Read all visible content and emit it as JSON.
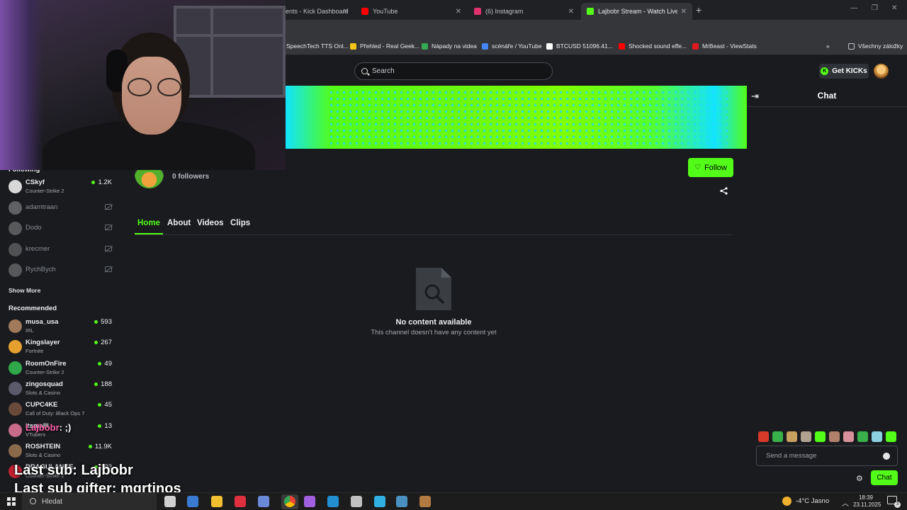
{
  "browser": {
    "tabs": [
      {
        "title": "ents - Kick Dashboard",
        "color": "#53fc18"
      },
      {
        "title": "YouTube",
        "color": "#ff0000"
      },
      {
        "title": "(6) Instagram",
        "color": "#e1306c"
      },
      {
        "title": "Lajbobr Stream - Watch Live on",
        "color": "#53fc18"
      }
    ],
    "bookmarks": [
      {
        "label": "SpeechTech TTS Onl...",
        "color": "#4aa3ff"
      },
      {
        "label": "Přehled - Real Geek...",
        "color": "#f5c518"
      },
      {
        "label": "Nápady na videa",
        "color": "#34a853"
      },
      {
        "label": "scénáře / YouTube",
        "color": "#4285f4"
      },
      {
        "label": "BTCUSD 51096.41...",
        "color": "#ffffff"
      },
      {
        "label": "Shocked sound effe...",
        "color": "#ff0000"
      },
      {
        "label": "MrBeast - ViewStats",
        "color": "#e0191f"
      },
      {
        "label": "Všechny záložky",
        "color": "#bdc1c6"
      }
    ]
  },
  "header": {
    "search_placeholder": "Search",
    "get_kicks_label": "Get KICKs"
  },
  "sidebar": {
    "following_title": "Following",
    "following": [
      {
        "name": "CSkyf",
        "category": "Counter-Strike 2",
        "viewers": "1.2K",
        "live": true,
        "color": "#d8d8d8"
      },
      {
        "name": "adamtraan",
        "live": false,
        "color": "#9a9a9a"
      },
      {
        "name": "Dodo",
        "live": false,
        "color": "#8c8c8c"
      },
      {
        "name": "krecmer",
        "live": false,
        "color": "#7d7d7d"
      },
      {
        "name": "RychBych",
        "live": false,
        "color": "#8a8a8a"
      }
    ],
    "show_more_label": "Show More",
    "recommended_title": "Recommended",
    "recommended": [
      {
        "name": "musa_usa",
        "category": "IRL",
        "viewers": "593",
        "color": "#a07a5a"
      },
      {
        "name": "Kingslayer",
        "category": "Fortnite",
        "viewers": "267",
        "color": "#e6a030"
      },
      {
        "name": "RoomOnFire",
        "category": "Counter-Strike 2",
        "viewers": "49",
        "color": "#2fa84a"
      },
      {
        "name": "zingosquad",
        "category": "Slots & Casino",
        "viewers": "188",
        "color": "#5a5a6a"
      },
      {
        "name": "CUPC4KE",
        "category": "Call of Duty: Black Ops 7",
        "viewers": "45",
        "color": "#6a4a3a"
      },
      {
        "name": "itsmalli",
        "category": "VTubers",
        "viewers": "13",
        "color": "#c86a8a"
      },
      {
        "name": "ROSHTEIN",
        "category": "Slots & Casino",
        "viewers": "11.9K",
        "color": "#8a6a4a"
      },
      {
        "name": "DRAGULANCE",
        "category": "Counter-Strike 2",
        "viewers": "383",
        "color": "#c02030"
      }
    ]
  },
  "channel": {
    "followers_text": "0 followers",
    "follow_label": "Follow",
    "tabs": [
      "Home",
      "About",
      "Videos",
      "Clips"
    ],
    "empty_title": "No content available",
    "empty_subtitle": "This channel doesn't have any content yet"
  },
  "chat": {
    "title": "Chat",
    "input_placeholder": "Send a message",
    "send_label": "Chat",
    "emote_colors": [
      "#d83a2a",
      "#3ab04a",
      "#c8a060",
      "#b0a090",
      "#53fc18",
      "#b0806a",
      "#d8909a",
      "#3ab04a",
      "#8ad0e0",
      "#53fc18"
    ]
  },
  "overlay": {
    "chat_user": "Lajbobr",
    "chat_message": ": ;)",
    "last_sub": "Last sub: Lajbobr",
    "last_gifter": "Last sub gifter: mqrtinos"
  },
  "taskbar": {
    "search_label": "Hledat",
    "apps": [
      {
        "icon": "task-view-icon",
        "color": "#d0d0d0"
      },
      {
        "icon": "calculator-app-icon",
        "color": "#3a7ad0"
      },
      {
        "icon": "file-explorer-icon",
        "color": "#f0c030"
      },
      {
        "icon": "app-red-icon",
        "color": "#e03040"
      },
      {
        "icon": "app-blue-icon",
        "color": "#6a8ad8"
      },
      {
        "icon": "chrome-icon",
        "color": "#f0b020"
      },
      {
        "icon": "app-purple-icon",
        "color": "#a060e0"
      },
      {
        "icon": "vegas-icon",
        "color": "#2090d0"
      },
      {
        "icon": "obs-icon",
        "color": "#c0c0c0"
      },
      {
        "icon": "app-cyan-icon",
        "color": "#30b0e0"
      },
      {
        "icon": "steam-icon",
        "color": "#4a90c0"
      },
      {
        "icon": "app-box-icon",
        "color": "#b07a40"
      }
    ],
    "weather": "-4°C  Jasno",
    "time": "18:39",
    "date": "23.11.2025",
    "notifications": "3"
  }
}
